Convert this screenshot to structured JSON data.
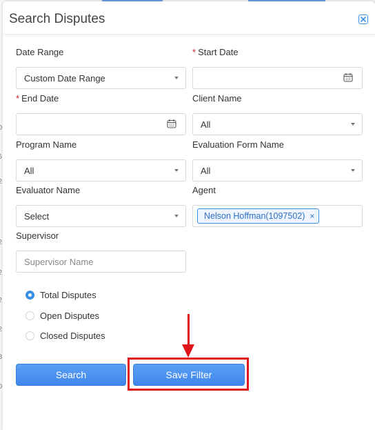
{
  "modal": {
    "title": "Search Disputes"
  },
  "form": {
    "date_range": {
      "label": "Date Range",
      "value": "Custom Date Range"
    },
    "start_date": {
      "required_mark": "*",
      "label": "Start Date",
      "value": ""
    },
    "end_date": {
      "required_mark": "*",
      "label": "End Date",
      "value": ""
    },
    "client_name": {
      "label": "Client Name",
      "value": "All"
    },
    "program_name": {
      "label": "Program Name",
      "value": "All"
    },
    "evaluation_form_name": {
      "label": "Evaluation Form Name",
      "value": "All"
    },
    "evaluator_name": {
      "label": "Evaluator Name",
      "value": "Select"
    },
    "agent": {
      "label": "Agent",
      "chip": "Nelson Hoffman(1097502)",
      "chip_remove": "×"
    },
    "supervisor": {
      "label": "Supervisor",
      "placeholder": "Supervisor Name"
    }
  },
  "dispute_type": {
    "options": [
      "Total Disputes",
      "Open Disputes",
      "Closed Disputes"
    ],
    "selected": "Total Disputes"
  },
  "buttons": {
    "search": "Search",
    "save_filter": "Save Filter"
  },
  "background_ticks": [
    "0",
    "5",
    "2",
    "2",
    "2",
    "2",
    "2",
    "8",
    "0"
  ],
  "colors": {
    "accent": "#3a8ee6",
    "button": "#4a90ee",
    "annotation": "#e0151c",
    "required": "#e02020"
  },
  "icons": {
    "close": "close-icon",
    "calendar": "calendar-icon",
    "caret": "chevron-down-icon"
  }
}
